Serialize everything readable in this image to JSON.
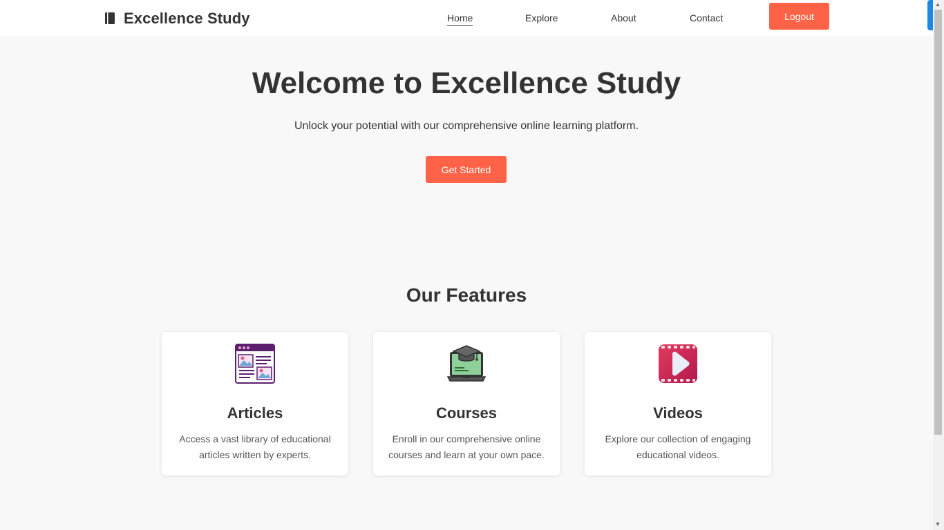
{
  "header": {
    "brand": "Excellence Study",
    "nav": [
      {
        "label": "Home",
        "active": true
      },
      {
        "label": "Explore",
        "active": false
      },
      {
        "label": "About",
        "active": false
      },
      {
        "label": "Contact",
        "active": false
      }
    ],
    "logout_label": "Logout"
  },
  "hero": {
    "title": "Welcome to Excellence Study",
    "subtitle": "Unlock your potential with our comprehensive online learning platform.",
    "cta_label": "Get Started"
  },
  "features": {
    "title": "Our Features",
    "cards": [
      {
        "icon": "articles-icon",
        "title": "Articles",
        "description": "Access a vast library of educational articles written by experts."
      },
      {
        "icon": "courses-icon",
        "title": "Courses",
        "description": "Enroll in our comprehensive online courses and learn at your own pace."
      },
      {
        "icon": "videos-icon",
        "title": "Videos",
        "description": "Explore our collection of engaging educational videos."
      }
    ]
  },
  "colors": {
    "accent": "#ff6347",
    "text": "#333333",
    "background": "#f8f8f8"
  }
}
